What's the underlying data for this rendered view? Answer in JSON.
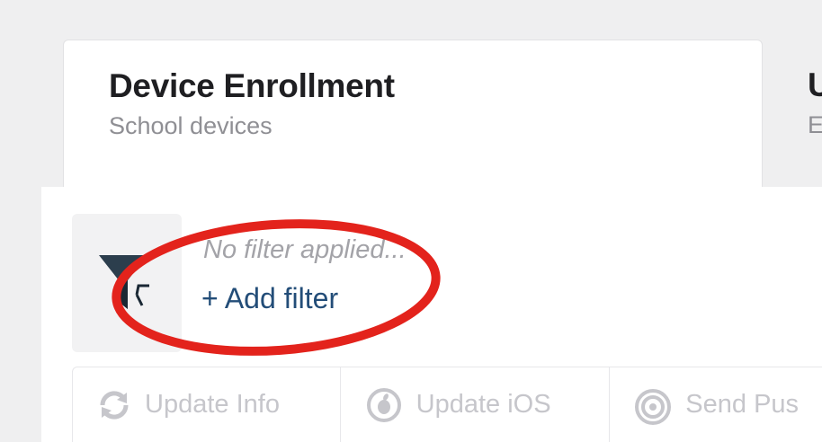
{
  "tabs": [
    {
      "title": "Device Enrollment",
      "subtitle": "School devices",
      "active": true
    },
    {
      "title": "U",
      "subtitle": "E",
      "active": false
    }
  ],
  "filter": {
    "empty_text": "No filter applied...",
    "add_label": "+ Add filter",
    "icon": "funnel-icon"
  },
  "toolbar": {
    "buttons": [
      {
        "label": "Update Info",
        "icon": "refresh-icon"
      },
      {
        "label": "Update iOS",
        "icon": "apple-update-icon"
      },
      {
        "label": "Send Pus",
        "icon": "broadcast-icon"
      }
    ]
  },
  "annotation": {
    "type": "highlight-ellipse",
    "color": "#e3231c"
  },
  "colors": {
    "background": "#efeff0",
    "link": "#234d78",
    "heading": "#1f1f22",
    "muted": "#8f8f94",
    "disabled": "#c6c6cb"
  }
}
